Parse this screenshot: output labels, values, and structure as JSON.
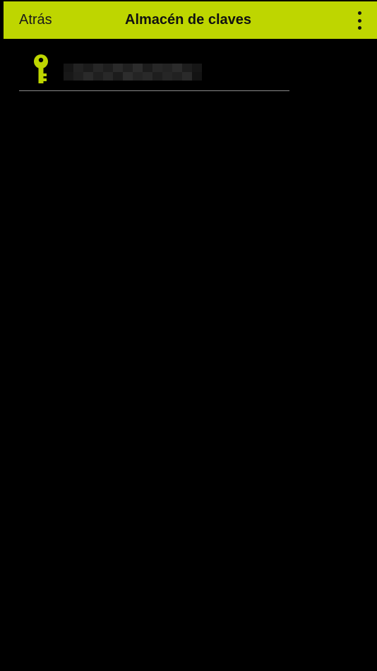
{
  "header": {
    "back_label": "Atrás",
    "title": "Almacén de claves",
    "menu_icon": "more-vertical-icon"
  },
  "keys": [
    {
      "name": "",
      "icon": "key-icon"
    }
  ],
  "colors": {
    "accent": "#bed600",
    "background": "#000000",
    "divider": "#8a8a8a"
  }
}
